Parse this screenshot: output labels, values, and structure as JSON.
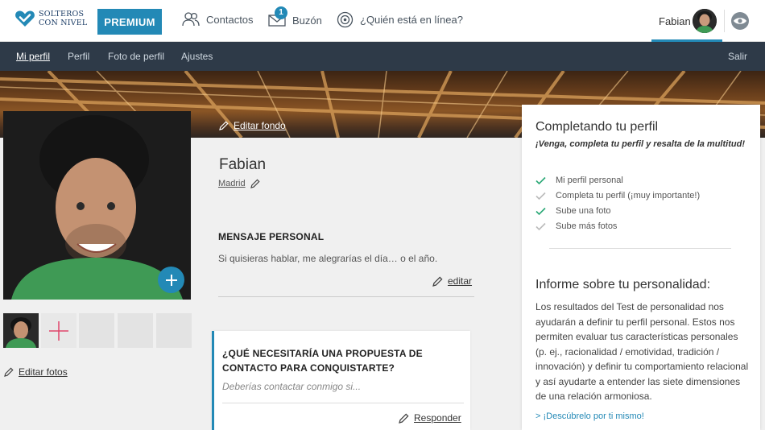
{
  "brand": {
    "name_line1": "SOLTEROS",
    "name_line2": "CON NIVEL",
    "accent_color": "#2389b6",
    "logo_color": "#1c3d66"
  },
  "topbar": {
    "premium_label": "PREMIUM",
    "contacts_label": "Contactos",
    "inbox_label": "Buzón",
    "inbox_badge": "1",
    "online_label": "¿Quién está en línea?",
    "user_name": "Fabian"
  },
  "subnav": {
    "items": [
      "Mi perfil",
      "Perfil",
      "Foto de perfil",
      "Ajustes"
    ],
    "active": "Mi perfil",
    "logout_label": "Salir"
  },
  "banner": {
    "edit_label": "Editar fondo"
  },
  "photos": {
    "edit_label": "Editar fotos"
  },
  "profile": {
    "name": "Fabian",
    "city": "Madrid",
    "personal_message_title": "MENSAJE PERSONAL",
    "personal_message_text": "Si quisieras hablar, me alegrarías el día… o el año.",
    "edit_label": "editar"
  },
  "question": {
    "title": "¿QUÉ NECESITARÍA UNA PROPUESTA DE CONTACTO PARA CONQUISTARTE?",
    "answer_placeholder": "Deberías contactar conmigo si...",
    "reply_label": "Responder"
  },
  "completion": {
    "title": "Completando tu perfil",
    "subtitle": "¡Venga, completa tu perfil y resalta de la multitud!",
    "items": [
      {
        "label": "Mi perfil personal",
        "done": true
      },
      {
        "label": "Completa tu perfil (¡muy importante!)",
        "done": false
      },
      {
        "label": "Sube una foto",
        "done": true
      },
      {
        "label": "Sube más fotos",
        "done": false
      }
    ]
  },
  "personality": {
    "title": "Informe sobre tu personalidad:",
    "text": "Los resultados del Test de personalidad nos ayudarán a definir tu perfil personal. Estos nos permiten evaluar tus características personales (p. ej., racionalidad / emotividad, tradición / innovación) y definir tu comportamiento relacional y así ayudarte a entender las siete dimensiones de una relación armoniosa.",
    "link_label": "> ¡Descúbrelo por ti mismo!"
  }
}
